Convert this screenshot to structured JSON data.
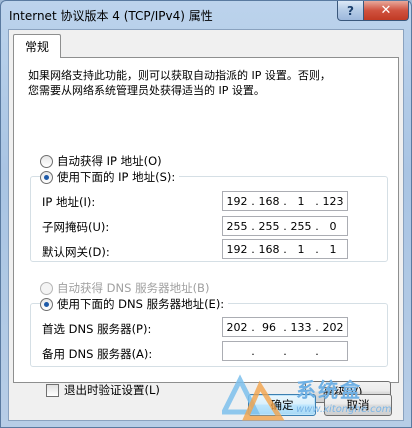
{
  "window": {
    "title": "Internet 协议版本 4 (TCP/IPv4) 属性",
    "help_glyph": "?",
    "close_glyph": "✕"
  },
  "tabs": [
    {
      "label": "常规"
    }
  ],
  "intro": {
    "line1": "如果网络支持此功能，则可以获取自动指派的 IP 设置。否则，",
    "line2": "您需要从网络系统管理员处获得适当的 IP 设置。"
  },
  "ip": {
    "auto_label": "自动获得 IP 地址(O)",
    "manual_label": "使用下面的 IP 地址(S):",
    "selected": "manual",
    "fields": [
      {
        "label": "IP 地址(I):",
        "octets": [
          "192",
          "168",
          "1",
          "123"
        ]
      },
      {
        "label": "子网掩码(U):",
        "octets": [
          "255",
          "255",
          "255",
          "0"
        ]
      },
      {
        "label": "默认网关(D):",
        "octets": [
          "192",
          "168",
          "1",
          "1"
        ]
      }
    ]
  },
  "dns": {
    "auto_label": "自动获得 DNS 服务器地址(B)",
    "manual_label": "使用下面的 DNS 服务器地址(E):",
    "selected": "manual",
    "fields": [
      {
        "label": "首选 DNS 服务器(P):",
        "octets": [
          "202",
          "96",
          "133",
          "202"
        ]
      },
      {
        "label": "备用 DNS 服务器(A):",
        "octets": [
          "",
          "",
          "",
          ""
        ]
      }
    ]
  },
  "validate_label": "退出时验证设置(L)",
  "validate_checked": false,
  "buttons": {
    "advanced": "高级(V)...",
    "ok": "确定",
    "cancel": "取消"
  },
  "watermark": {
    "brand": "系统盒",
    "url": "www.xitonghe.com"
  },
  "colors": {
    "accent": "#1e5aa8",
    "close_red": "#c13a24"
  }
}
